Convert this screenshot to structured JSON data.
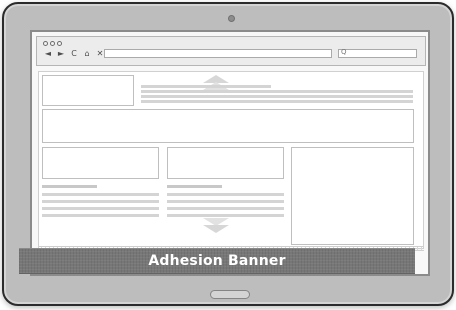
{
  "device": {
    "home_button": "",
    "camera": ""
  },
  "browser": {
    "controls": [
      "◄",
      "►",
      "C",
      "⌂",
      "✕",
      "+"
    ],
    "address": "",
    "search_placeholder": "Q",
    "icon_names": [
      "back-icon",
      "forward-icon",
      "refresh-icon",
      "home-icon",
      "close-icon",
      "add-icon"
    ]
  },
  "banner": {
    "label": "Adhesion Banner"
  }
}
